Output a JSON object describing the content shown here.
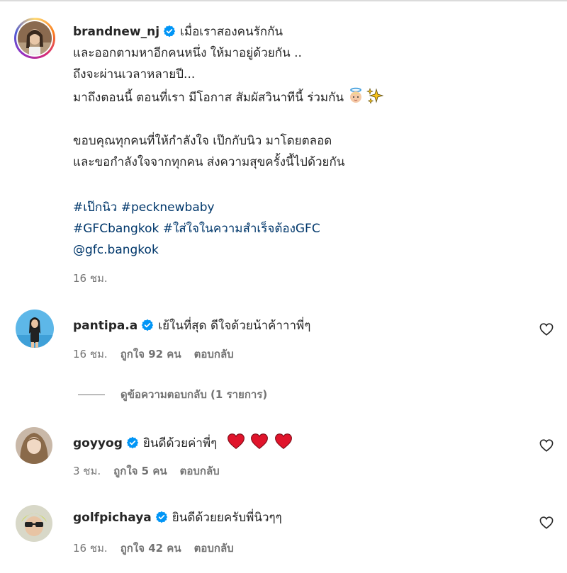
{
  "post": {
    "username": "brandnew_nj",
    "caption_lines": [
      "เมื่อเราสองคนรักกัน",
      "และออกตามหาอีกคนหนึ่ง ให้มาอยู่ด้วยกัน ..",
      "ถึงจะผ่านเวลาหลายปี...",
      "มาถึงตอนนี้ ตอนที่เรา มีโอกาส สัมผัสวินาทีนี้ ร่วมกัน",
      "ขอบคุณทุกคนที่ให้กำลังใจ เป๊กกับนิว มาโดยตลอด",
      "และขอกำลังใจจากทุกคน ส่งความสุขครั้งนี้ไปด้วยกัน"
    ],
    "emojis": [
      "baby-angel-emoji",
      "sparkles-emoji"
    ],
    "hashtags_line1": "#เป๊กนิว #pecknewbaby",
    "hashtags_line2": "#GFCbangkok #ใส่ใจในความสำเร็จต้องGFC",
    "mention": "@gfc.bangkok",
    "time": "16 ชม."
  },
  "comments": [
    {
      "username": "pantipa.a",
      "text": "เย้ในที่สุด ดีใจด้วยน้าค้าาาพี่ๆ",
      "time": "16 ชม.",
      "likes": "ถูกใจ 92 คน",
      "reply": "ตอบกลับ",
      "view_replies": "ดูข้อความตอบกลับ (1 รายการ)"
    },
    {
      "username": "goyyog",
      "text": "ยินดีด้วยค่าพี่ๆ",
      "time": "3 ชม.",
      "likes": "ถูกใจ 5 คน",
      "reply": "ตอบกลับ",
      "hearts": 3
    },
    {
      "username": "golfpichaya",
      "text": "ยินดีด้วยยครับพี่นิวๆๆ",
      "time": "16 ชม.",
      "likes": "ถูกใจ 42 คน",
      "reply": "ตอบกลับ"
    }
  ],
  "colors": {
    "verified": "#0095f6",
    "hashtag": "#00376b",
    "meta": "#737373",
    "heart_emoji": "#e0142b"
  }
}
